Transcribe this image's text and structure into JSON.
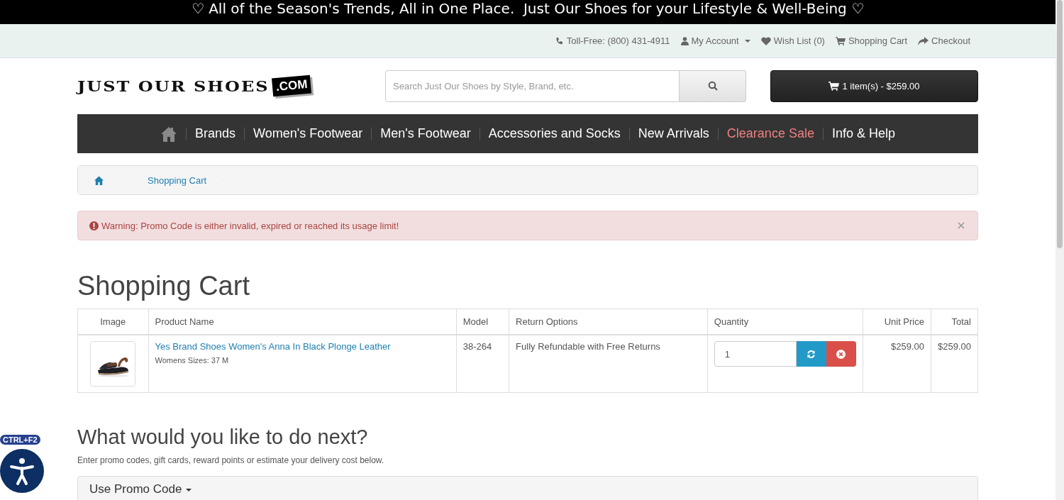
{
  "banner": "♡ All of the Season's Trends, All in One Place.  Just Our Shoes for your Lifestyle & Well-Being ♡",
  "top_links": [
    {
      "kind": "phone",
      "label": "Toll-Free: (800) 431-4911"
    },
    {
      "kind": "account",
      "label": "My Account",
      "dropdown": true
    },
    {
      "kind": "wishlist",
      "label": "Wish List (0)"
    },
    {
      "kind": "cart",
      "label": "Shopping Cart"
    },
    {
      "kind": "checkout",
      "label": "Checkout"
    }
  ],
  "logo": {
    "name": "JUST OUR SHOES",
    "suffix": ".COM"
  },
  "search": {
    "placeholder": "Search Just Our Shoes by Style, Brand, etc."
  },
  "cart_button": "1 item(s) - $259.00",
  "nav": [
    {
      "label": "Brands",
      "highlighted": false
    },
    {
      "label": "Women's Footwear",
      "highlighted": false
    },
    {
      "label": "Men's Footwear",
      "highlighted": false
    },
    {
      "label": "Accessories and Socks",
      "highlighted": false
    },
    {
      "label": "New Arrivals",
      "highlighted": false
    },
    {
      "label": "Clearance Sale",
      "highlighted": true
    },
    {
      "label": "Info & Help",
      "highlighted": false
    }
  ],
  "breadcrumb": [
    "Shopping Cart"
  ],
  "alert": "Warning: Promo Code is either invalid, expired or reached its usage limit!",
  "title": "Shopping Cart",
  "table": {
    "columns": [
      "Image",
      "Product Name",
      "Model",
      "Return Options",
      "Quantity",
      "Unit Price",
      "Total"
    ],
    "rows": [
      {
        "name": "Yes Brand Shoes Women's Anna In Black Plonge Leather",
        "option": "Womens Sizes: 37 M",
        "model": "38-264",
        "returns": "Fully Refundable with Free Returns",
        "quantity": "1",
        "unit_price": "$259.00",
        "total": "$259.00"
      }
    ]
  },
  "next": {
    "title": "What would you like to do next?",
    "text": "Enter promo codes, gift cards, reward points or estimate your delivery cost below.",
    "panel": "Use Promo Code"
  },
  "accessibility_badge": "CTRL+F2"
}
